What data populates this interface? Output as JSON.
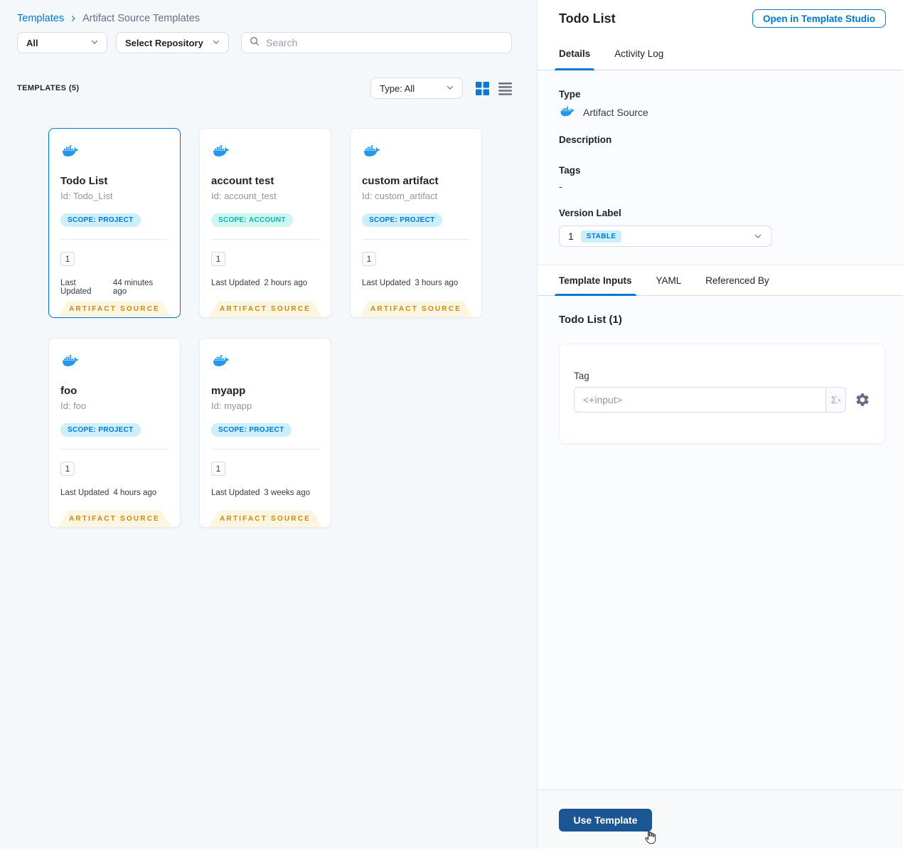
{
  "breadcrumb": {
    "root": "Templates",
    "current": "Artifact Source Templates"
  },
  "filters": {
    "scope": "All",
    "repository": "Select Repository",
    "search_placeholder": "Search"
  },
  "list_header": {
    "count": "TEMPLATES (5)",
    "type_filter": "Type: All"
  },
  "card_shared": {
    "last_updated_label": "Last Updated",
    "ribbon": "ARTIFACT SOURCE"
  },
  "cards": [
    {
      "title": "Todo List",
      "id": "Id: Todo_List",
      "scope": "SCOPE: PROJECT",
      "scope_type": "project",
      "version": "1",
      "last_updated": "44 minutes ago",
      "selected": true
    },
    {
      "title": "account test",
      "id": "Id: account_test",
      "scope": "SCOPE: ACCOUNT",
      "scope_type": "account",
      "version": "1",
      "last_updated": "2 hours ago",
      "selected": false
    },
    {
      "title": "custom artifact",
      "id": "Id: custom_artifact",
      "scope": "SCOPE: PROJECT",
      "scope_type": "project",
      "version": "1",
      "last_updated": "3 hours ago",
      "selected": false
    },
    {
      "title": "foo",
      "id": "Id: foo",
      "scope": "SCOPE: PROJECT",
      "scope_type": "project",
      "version": "1",
      "last_updated": "4 hours ago",
      "selected": false
    },
    {
      "title": "myapp",
      "id": "Id: myapp",
      "scope": "SCOPE: PROJECT",
      "scope_type": "project",
      "version": "1",
      "last_updated": "3 weeks ago",
      "selected": false
    }
  ],
  "panel": {
    "title": "Todo List",
    "open_studio": "Open in Template Studio",
    "tabs": {
      "details": "Details",
      "activity": "Activity Log"
    },
    "details": {
      "type_label": "Type",
      "type_value": "Artifact Source",
      "description_label": "Description",
      "tags_label": "Tags",
      "tags_value": "-",
      "version_label": "Version Label",
      "version_value": "1",
      "version_badge": "STABLE"
    },
    "sub_tabs": {
      "inputs": "Template Inputs",
      "yaml": "YAML",
      "referenced": "Referenced By"
    },
    "inputs": {
      "title": "Todo List (1)",
      "tag_label": "Tag",
      "tag_value": "<+input>",
      "expression_sigma": "Σ",
      "expression_sup": "x"
    },
    "footer": {
      "use_template": "Use Template"
    }
  },
  "colors": {
    "primary_blue": "#0278d5",
    "docker_blue": "#2396ed",
    "use_template_bg": "#1b5693",
    "ribbon_text": "#d1880e",
    "account_teal": "#0ab5aa"
  }
}
